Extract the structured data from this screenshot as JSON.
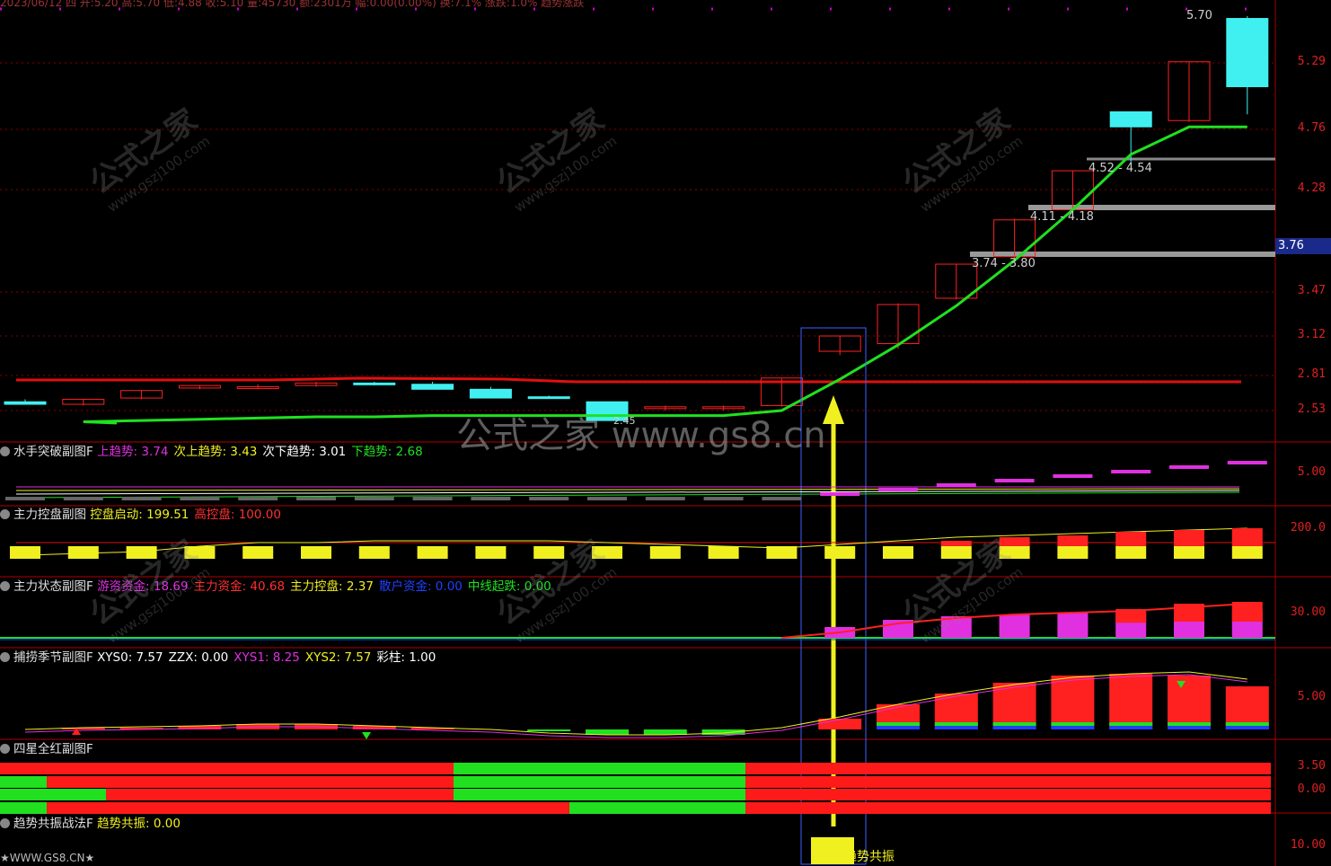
{
  "main": {
    "candles": [
      {
        "o": 2.6,
        "h": 2.62,
        "l": 2.58,
        "c": 2.58
      },
      {
        "o": 2.58,
        "h": 2.62,
        "l": 2.57,
        "c": 2.62
      },
      {
        "o": 2.63,
        "h": 2.69,
        "l": 2.62,
        "c": 2.69
      },
      {
        "o": 2.71,
        "h": 2.73,
        "l": 2.7,
        "c": 2.73
      },
      {
        "o": 2.72,
        "h": 2.74,
        "l": 2.71,
        "c": 2.72
      },
      {
        "o": 2.73,
        "h": 2.76,
        "l": 2.72,
        "c": 2.75
      },
      {
        "o": 2.75,
        "h": 2.76,
        "l": 2.73,
        "c": 2.74
      },
      {
        "o": 2.74,
        "h": 2.76,
        "l": 2.7,
        "c": 2.7
      },
      {
        "o": 2.7,
        "h": 2.72,
        "l": 2.63,
        "c": 2.63
      },
      {
        "o": 2.64,
        "h": 2.65,
        "l": 2.63,
        "c": 2.63
      },
      {
        "o": 2.6,
        "h": 2.6,
        "l": 2.45,
        "c": 2.45
      },
      {
        "o": 2.55,
        "h": 2.57,
        "l": 2.53,
        "c": 2.56
      },
      {
        "o": 2.55,
        "h": 2.57,
        "l": 2.53,
        "c": 2.56
      },
      {
        "o": 2.57,
        "h": 2.79,
        "l": 2.56,
        "c": 2.79
      },
      {
        "o": 3.0,
        "h": 3.12,
        "l": 2.97,
        "c": 3.12
      },
      {
        "o": 3.06,
        "h": 3.38,
        "l": 3.02,
        "c": 3.37
      },
      {
        "o": 3.42,
        "h": 3.69,
        "l": 3.41,
        "c": 3.69
      },
      {
        "o": 3.75,
        "h": 4.05,
        "l": 3.74,
        "c": 4.04
      },
      {
        "o": 4.12,
        "h": 4.43,
        "l": 4.1,
        "c": 4.43
      },
      {
        "o": 4.9,
        "h": 4.9,
        "l": 4.48,
        "c": 4.78
      },
      {
        "o": 4.83,
        "h": 5.3,
        "l": 4.82,
        "c": 5.3
      },
      {
        "o": 5.68,
        "h": 5.7,
        "l": 4.88,
        "c": 5.1
      }
    ],
    "red_line": 2.76,
    "green_line": [
      2.43,
      2.44,
      2.45,
      2.46,
      2.47,
      2.48,
      2.48,
      2.49,
      2.49,
      2.49,
      2.49,
      2.49,
      2.49,
      2.53,
      2.78,
      3.05,
      3.36,
      3.72,
      4.12,
      4.56,
      4.78,
      4.78
    ],
    "y_ticks": [
      "5.29",
      "4.76",
      "4.28",
      "3.47",
      "3.12",
      "2.81",
      "2.53"
    ],
    "top_price_label": "5.70",
    "last_price_tag": "3.76",
    "low_label": "2.45",
    "zones": [
      {
        "label": "4.52 - 4.54"
      },
      {
        "label": "4.11 - 4.18"
      },
      {
        "label": "3.74 - 3.80"
      }
    ],
    "watermark_center": "公式之家 www.gs8.cn",
    "top_strip": "2023/06/12 四 开:5.20 高:5.70 低:4.88 收:5.10 量:45730 额:2301万 幅:0.00(0.00%) 换:7.1% 涨跌:1.0% 趋势涨跌"
  },
  "watermark": {
    "cn": "公式之家",
    "url": "www.gszj100.com"
  },
  "panels": {
    "p1": {
      "name": "水手突破副图F",
      "items": [
        {
          "k": "上趋势",
          "v": "3.74",
          "c": "#e030e0"
        },
        {
          "k": "次上趋势",
          "v": "3.43",
          "c": "#f0f020"
        },
        {
          "k": "次下趋势",
          "v": "3.01",
          "c": "#ffffff"
        },
        {
          "k": "下趋势",
          "v": "2.68",
          "c": "#20e020"
        }
      ],
      "tick": "5.00"
    },
    "p2": {
      "name": "主力控盘副图",
      "items": [
        {
          "k": "控盘启动",
          "v": "199.51",
          "c": "#f0f020"
        },
        {
          "k": "高控盘",
          "v": "100.00",
          "c": "#ff3030"
        }
      ],
      "tick": "200.0"
    },
    "p3": {
      "name": "主力状态副图F",
      "items": [
        {
          "k": "游资资金",
          "v": "18.69",
          "c": "#e030e0"
        },
        {
          "k": "主力资金",
          "v": "40.68",
          "c": "#ff3030"
        },
        {
          "k": "主力控盘",
          "v": "2.37",
          "c": "#f0f020"
        },
        {
          "k": "散户资金",
          "v": "0.00",
          "c": "#2040ff"
        },
        {
          "k": "中线起跌",
          "v": "0.00",
          "c": "#20e020"
        }
      ],
      "tick": "30.00"
    },
    "p4": {
      "name": "捕捞季节副图F",
      "items": [
        {
          "k": "XYS0",
          "v": "7.57",
          "c": "#ffffff"
        },
        {
          "k": "ZZX",
          "v": "0.00",
          "c": "#ffffff"
        },
        {
          "k": "XYS1",
          "v": "8.25",
          "c": "#e030e0"
        },
        {
          "k": "XYS2",
          "v": "7.57",
          "c": "#f0f020"
        },
        {
          "k": "彩柱",
          "v": "1.00",
          "c": "#ffffff"
        }
      ],
      "tick": "5.00"
    },
    "p5": {
      "name": "四星全红副图F",
      "items": [],
      "ticks": [
        "3.50",
        "0.00"
      ]
    },
    "p6": {
      "name": "趋势共振战法F",
      "items": [
        {
          "k": "趋势共振",
          "v": "0.00",
          "c": "#f0f020"
        }
      ],
      "tick": "10.00",
      "signal_label": "趋势共振"
    }
  },
  "footer": "★WWW.GS8.CN★",
  "colors": {
    "up": "#ff2020",
    "down": "#40f0f0",
    "grid": "#8a0000",
    "green": "#20e020",
    "yellow": "#f0f020",
    "magenta": "#e030e0"
  }
}
